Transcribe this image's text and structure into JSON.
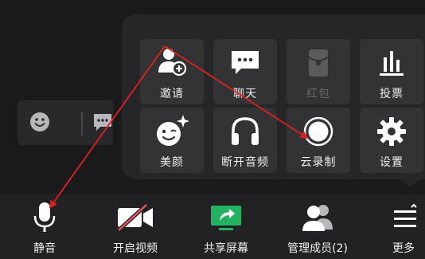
{
  "panel": {
    "row1": [
      {
        "label": "邀请",
        "icon": "invite-user-icon"
      },
      {
        "label": "聊天",
        "icon": "chat-icon"
      },
      {
        "label": "红包",
        "icon": "red-packet-icon"
      },
      {
        "label": "投票",
        "icon": "vote-icon"
      }
    ],
    "row2": [
      {
        "label": "美颜",
        "icon": "beauty-face-icon"
      },
      {
        "label": "断开音频",
        "icon": "headphones-icon"
      },
      {
        "label": "云录制",
        "icon": "record-icon"
      },
      {
        "label": "设置",
        "icon": "gear-icon"
      }
    ]
  },
  "bottom_bar": [
    {
      "label": "静音",
      "icon": "microphone-icon"
    },
    {
      "label": "开启视频",
      "icon": "video-off-icon"
    },
    {
      "label": "共享屏幕",
      "icon": "share-screen-icon"
    },
    {
      "label": "管理成员(2)",
      "icon": "members-icon"
    },
    {
      "label": "更多",
      "icon": "more-icon"
    }
  ],
  "colors": {
    "background": "#1a1a1c",
    "tile": "#333336",
    "accent_green": "#21b35f",
    "annotation_red": "#e02020",
    "record_white": "#ffffff"
  }
}
